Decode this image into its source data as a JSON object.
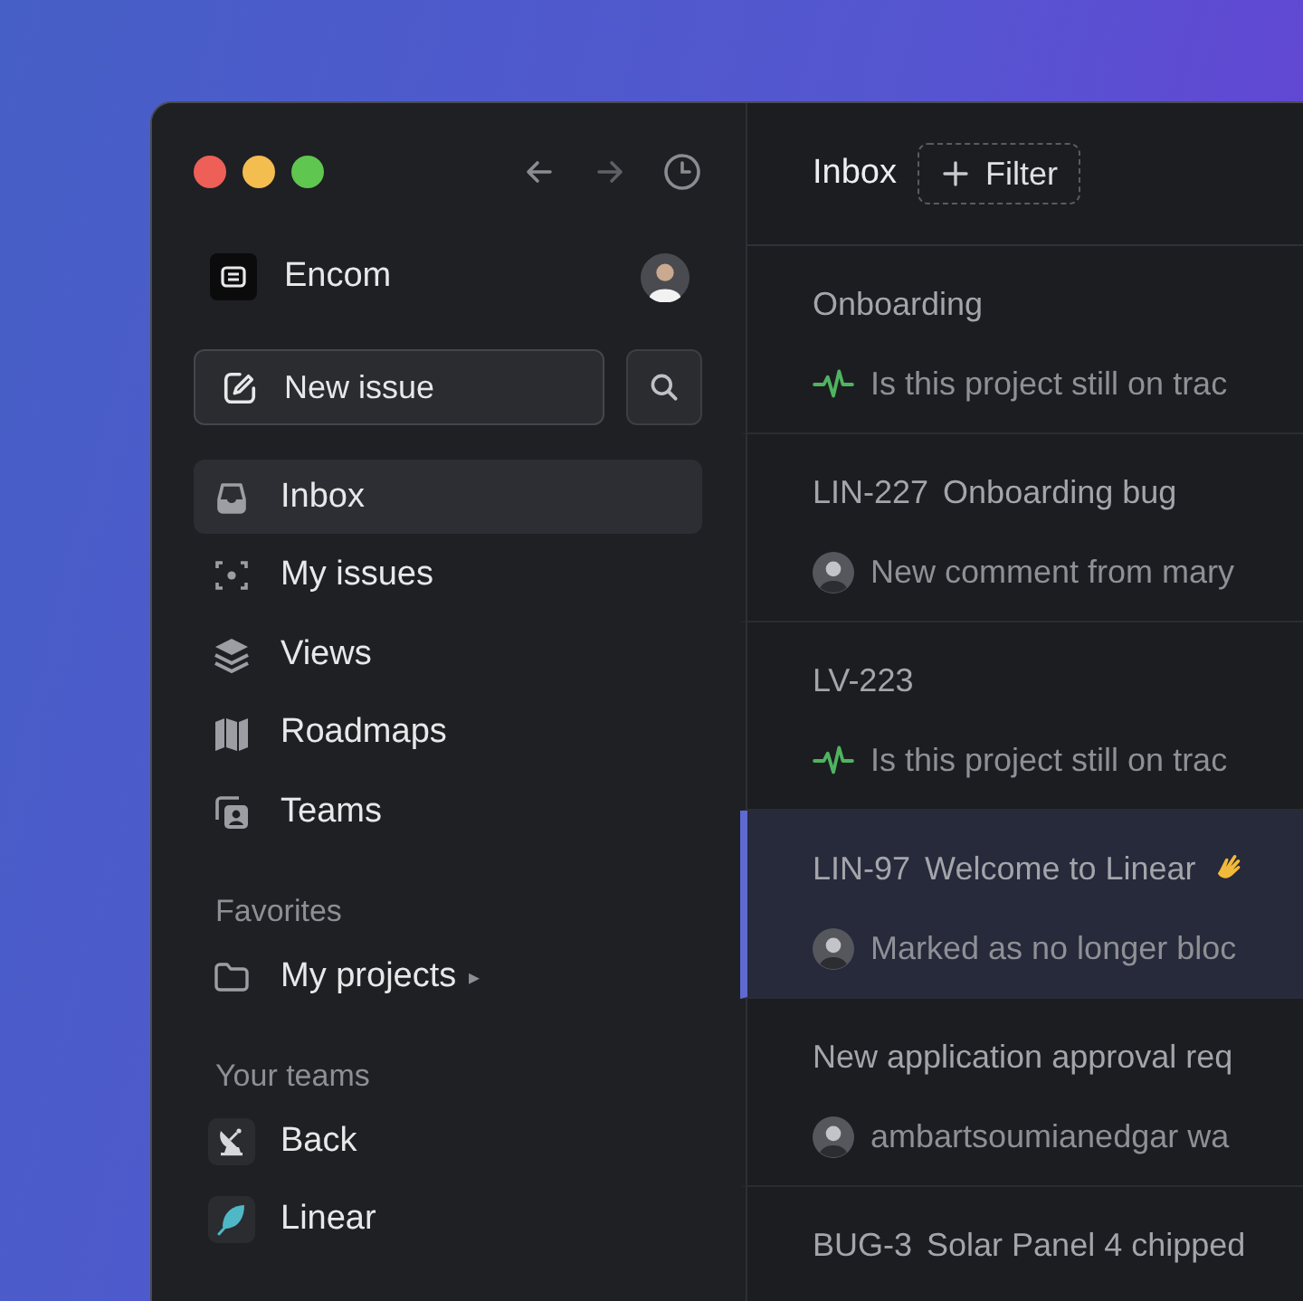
{
  "workspace": {
    "name": "Encom"
  },
  "new_issue": {
    "label": "New issue"
  },
  "nav": [
    {
      "label": "Inbox",
      "kind": "inbox",
      "selected": true
    },
    {
      "label": "My issues",
      "kind": "target",
      "selected": false
    },
    {
      "label": "Views",
      "kind": "layers",
      "selected": false
    },
    {
      "label": "Roadmaps",
      "kind": "map",
      "selected": false
    },
    {
      "label": "Teams",
      "kind": "team",
      "selected": false
    }
  ],
  "favorites": {
    "heading": "Favorites",
    "items": [
      {
        "label": "My projects",
        "arrow": "▸"
      }
    ]
  },
  "teams": {
    "heading": "Your teams",
    "items": [
      {
        "label": "Back",
        "kind": "dish"
      },
      {
        "label": "Linear",
        "kind": "feather"
      }
    ]
  },
  "header": {
    "title": "Inbox",
    "filter": "Filter"
  },
  "notifications": [
    {
      "title": "Onboarding",
      "detail": "Is this project still on trac",
      "kind": "pulse",
      "selected": false
    },
    {
      "id": "LIN-227",
      "title": "Onboarding bug",
      "detail": "New comment from mary",
      "kind": "avatar",
      "selected": false
    },
    {
      "id": "LV-223",
      "detail": "Is this project still on trac",
      "kind": "pulse",
      "selected": false
    },
    {
      "id": "LIN-97",
      "title": "Welcome to Linear",
      "wave": true,
      "detail": "Marked as no longer bloc",
      "kind": "avatar",
      "selected": true
    },
    {
      "title": "New application approval req",
      "detail": "ambartsoumianedgar wa",
      "kind": "avatar",
      "selected": false
    },
    {
      "id": "BUG-3",
      "title": "Solar Panel 4 chipped",
      "selected": false
    }
  ]
}
